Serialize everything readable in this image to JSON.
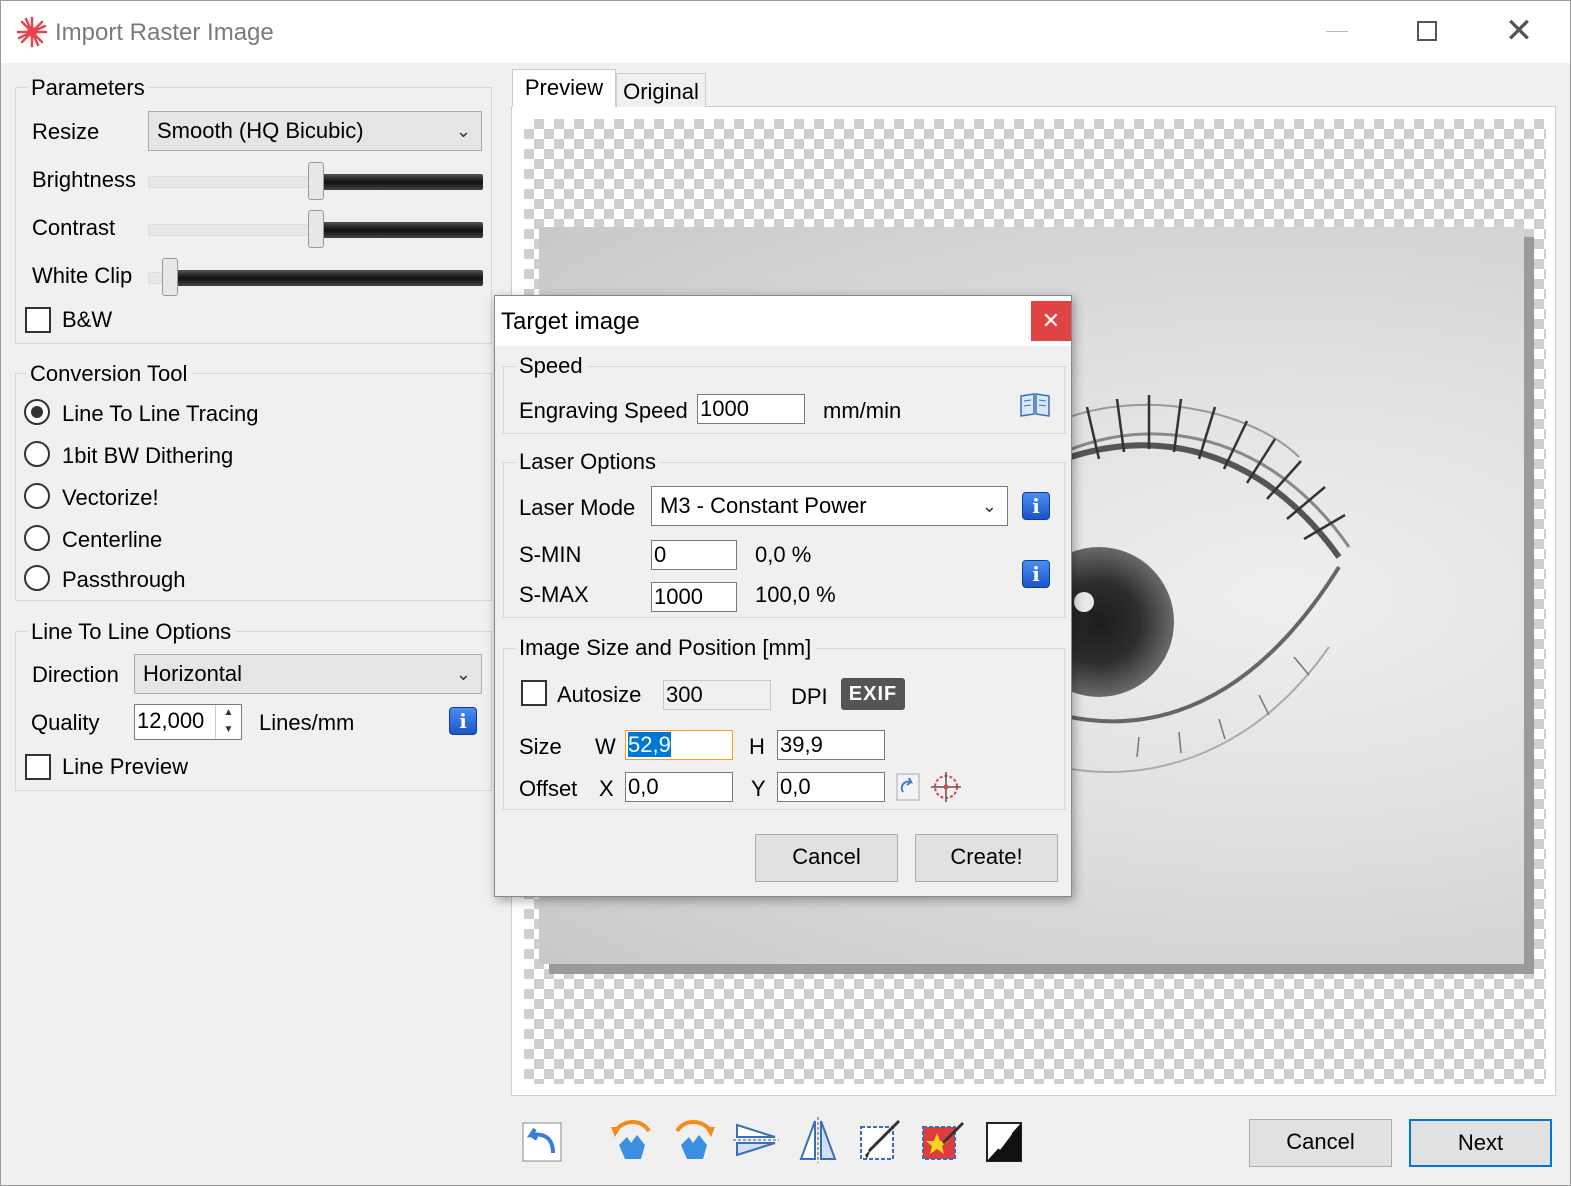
{
  "window": {
    "title": "Import Raster Image"
  },
  "parameters": {
    "title": "Parameters",
    "resize_label": "Resize",
    "resize_value": "Smooth (HQ Bicubic)",
    "brightness_label": "Brightness",
    "brightness_level": 0.5,
    "contrast_label": "Contrast",
    "contrast_level": 0.5,
    "white_clip_label": "White Clip",
    "white_clip_level": 0.05,
    "bw_label": "B&W",
    "bw_checked": false
  },
  "conversion": {
    "title": "Conversion Tool",
    "options": [
      {
        "label": "Line To Line Tracing",
        "selected": true
      },
      {
        "label": "1bit BW Dithering",
        "selected": false
      },
      {
        "label": "Vectorize!",
        "selected": false
      },
      {
        "label": "Centerline",
        "selected": false
      },
      {
        "label": "Passthrough",
        "selected": false
      }
    ]
  },
  "line_options": {
    "title": "Line To Line Options",
    "direction_label": "Direction",
    "direction_value": "Horizontal",
    "quality_label": "Quality",
    "quality_value": "12,000",
    "quality_unit": "Lines/mm",
    "line_preview_label": "Line Preview",
    "line_preview_checked": false
  },
  "tabs": [
    {
      "label": "Preview",
      "active": true
    },
    {
      "label": "Original",
      "active": false
    }
  ],
  "footer": {
    "cancel_label": "Cancel",
    "next_label": "Next",
    "tools": [
      "reset-icon",
      "rotate-left-icon",
      "rotate-right-icon",
      "flip-horizontal-icon",
      "flip-vertical-icon",
      "crop-icon",
      "auto-crop-icon",
      "invert-icon"
    ]
  },
  "dialog": {
    "title": "Target image",
    "speed": {
      "title": "Speed",
      "label": "Engraving Speed",
      "value": "1000",
      "unit": "mm/min"
    },
    "laser": {
      "title": "Laser Options",
      "mode_label": "Laser Mode",
      "mode_value": "M3 - Constant Power",
      "smin_label": "S-MIN",
      "smin_value": "0",
      "smin_percent": "0,0 %",
      "smax_label": "S-MAX",
      "smax_value": "1000",
      "smax_percent": "100,0 %"
    },
    "size": {
      "title": "Image Size and Position [mm]",
      "autosize_label": "Autosize",
      "autosize_checked": false,
      "dpi_value": "300",
      "dpi_label": "DPI",
      "exif_label": "EXIF",
      "size_label": "Size",
      "w_label": "W",
      "w_value": "52,9",
      "h_label": "H",
      "h_value": "39,9",
      "offset_label": "Offset",
      "x_label": "X",
      "x_value": "0,0",
      "y_label": "Y",
      "y_value": "0,0"
    },
    "cancel_label": "Cancel",
    "create_label": "Create!"
  },
  "colors": {
    "accent": "#0078d7",
    "close_red": "#e04343",
    "info_blue": "#1a54c8",
    "focus_orange": "#ff9a1a"
  }
}
